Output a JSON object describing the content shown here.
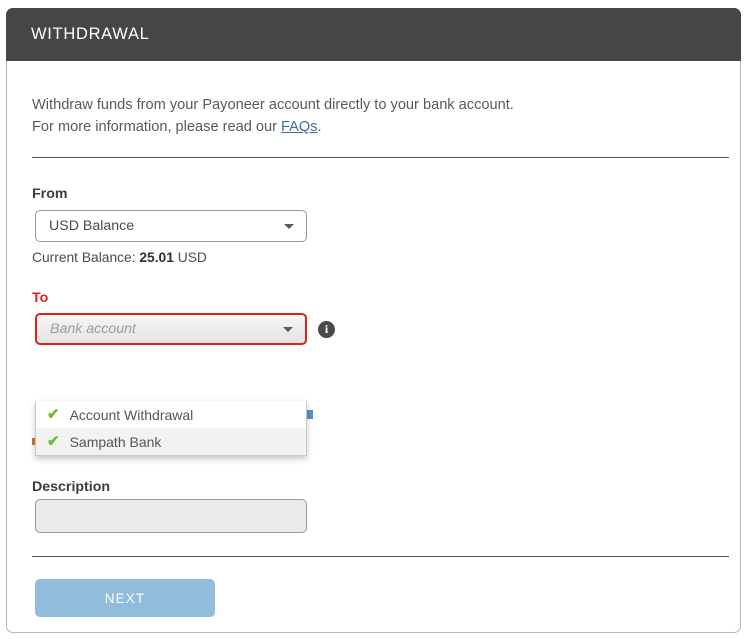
{
  "header": {
    "title": "WITHDRAWAL"
  },
  "intro": {
    "line1": "Withdraw funds from your Payoneer account directly to your bank account.",
    "line2_prefix": "For more information, please read our ",
    "faq_link": "FAQs",
    "line2_suffix": "."
  },
  "from_section": {
    "label": "From",
    "selected_value": "USD Balance",
    "balance_prefix": "Current Balance: ",
    "balance_amount": "25.01",
    "balance_currency": " USD"
  },
  "to_section": {
    "label": "To",
    "placeholder": "Bank account",
    "info_icon_glyph": "i",
    "options": [
      {
        "label": "Account Withdrawal",
        "check": "✔",
        "highlighted": false
      },
      {
        "label": "Sampath Bank",
        "check": "✔",
        "highlighted": true
      }
    ]
  },
  "amount_section": {
    "value": ""
  },
  "description_section": {
    "label": "Description",
    "value": ""
  },
  "footer": {
    "next_label": "NEXT"
  },
  "colors": {
    "header_bg": "#464646",
    "error": "#e02020",
    "link": "#3b6ea5",
    "check_green": "#6cbe2f",
    "button_blue": "#90bddb"
  }
}
